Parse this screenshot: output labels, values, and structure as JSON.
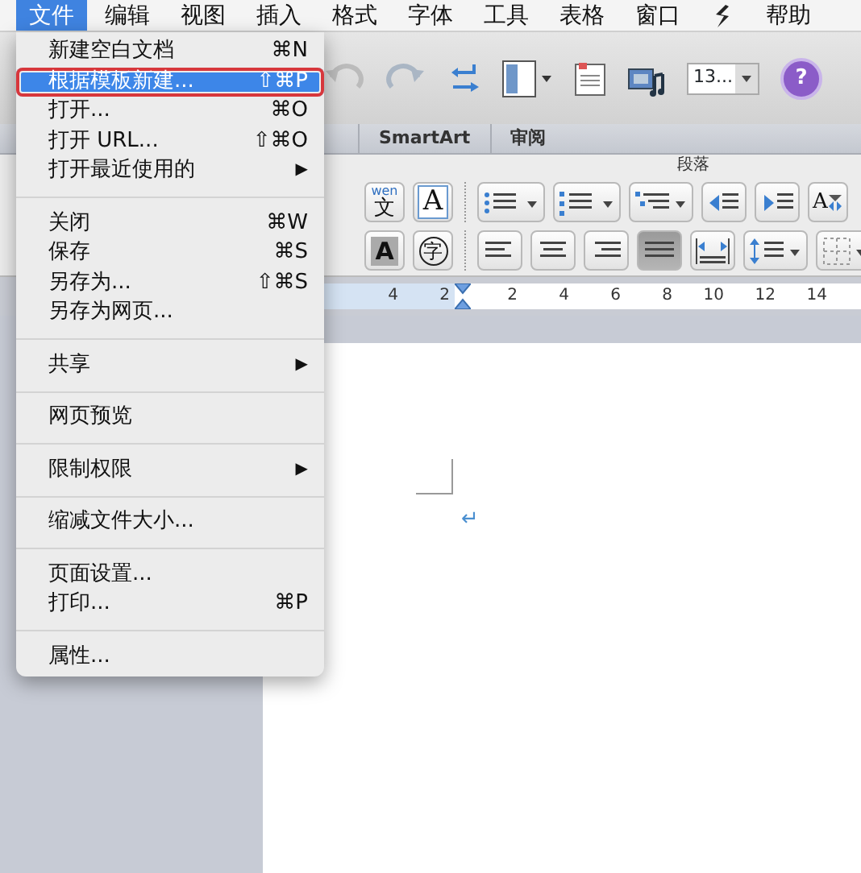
{
  "menu_bar": {
    "items": [
      {
        "kind": "text",
        "label": "文件",
        "selected": true
      },
      {
        "kind": "text",
        "label": "编辑",
        "selected": false
      },
      {
        "kind": "text",
        "label": "视图",
        "selected": false
      },
      {
        "kind": "text",
        "label": "插入",
        "selected": false
      },
      {
        "kind": "text",
        "label": "格式",
        "selected": false
      },
      {
        "kind": "text",
        "label": "字体",
        "selected": false
      },
      {
        "kind": "text",
        "label": "工具",
        "selected": false
      },
      {
        "kind": "text",
        "label": "表格",
        "selected": false
      },
      {
        "kind": "text",
        "label": "窗口",
        "selected": false
      },
      {
        "kind": "icon",
        "selected": false
      },
      {
        "kind": "text",
        "label": "帮助",
        "selected": false
      }
    ]
  },
  "file_menu": {
    "groups": [
      [
        {
          "label": "新建空白文档",
          "shortcut": "⌘N",
          "selected": false,
          "outlined": false
        },
        {
          "label": "根据模板新建...",
          "shortcut": "⇧⌘P",
          "selected": true,
          "outlined": true
        },
        {
          "label": "打开...",
          "shortcut": "⌘O",
          "selected": false,
          "outlined": false
        },
        {
          "label": "打开 URL...",
          "shortcut": "⇧⌘O",
          "selected": false,
          "outlined": false
        },
        {
          "label": "打开最近使用的",
          "submenu_arrow": "▶",
          "selected": false,
          "outlined": false
        }
      ],
      [
        {
          "label": "关闭",
          "shortcut": "⌘W",
          "selected": false,
          "outlined": false
        },
        {
          "label": "保存",
          "shortcut": "⌘S",
          "selected": false,
          "outlined": false
        },
        {
          "label": "另存为...",
          "shortcut": "⇧⌘S",
          "selected": false,
          "outlined": false
        },
        {
          "label": "另存为网页...",
          "selected": false,
          "outlined": false
        }
      ],
      [
        {
          "label": "共享",
          "submenu_arrow": "▶",
          "selected": false,
          "outlined": false
        }
      ],
      [
        {
          "label": "网页预览",
          "selected": false,
          "outlined": false
        }
      ],
      [
        {
          "label": "限制权限",
          "submenu_arrow": "▶",
          "selected": false,
          "outlined": false
        }
      ],
      [
        {
          "label": "缩减文件大小...",
          "selected": false,
          "outlined": false
        }
      ],
      [
        {
          "label": "页面设置...",
          "selected": false,
          "outlined": false
        },
        {
          "label": "打印...",
          "shortcut": "⌘P",
          "selected": false,
          "outlined": false
        }
      ],
      [
        {
          "label": "属性...",
          "selected": false,
          "outlined": false
        }
      ]
    ]
  },
  "toolbar": {
    "zoom": {
      "value": "13..."
    },
    "help": "?"
  },
  "ribbon_tabs": [
    {
      "label": "SmartArt"
    },
    {
      "label": "审阅"
    }
  ],
  "ribbon": {
    "group_title": "段落",
    "row_1": [
      {
        "kind": "phonetic",
        "top": "wen",
        "glyph": "文"
      },
      {
        "kind": "boxed-char",
        "glyph": "A"
      },
      {
        "kind": "bullets"
      },
      {
        "kind": "numbering"
      },
      {
        "kind": "multilevel"
      },
      {
        "kind": "outdent"
      },
      {
        "kind": "indent"
      },
      {
        "kind": "text-direction",
        "glyph": "A"
      }
    ],
    "row_2": [
      {
        "kind": "shaded-char",
        "glyph": "A"
      },
      {
        "kind": "enclosed-char",
        "glyph": "字"
      },
      {
        "kind": "align-left",
        "selected": false
      },
      {
        "kind": "align-center",
        "selected": false
      },
      {
        "kind": "align-right",
        "selected": false
      },
      {
        "kind": "justify",
        "selected": true
      },
      {
        "kind": "distributed",
        "selected": false
      },
      {
        "kind": "line-spacing"
      },
      {
        "kind": "borders"
      }
    ]
  },
  "ruler": {
    "left_marks": [
      "4",
      "2"
    ],
    "right_marks": [
      "2",
      "4",
      "6",
      "8",
      "10",
      "12",
      "14"
    ]
  },
  "document": {
    "paragraph_mark": "↵"
  }
}
